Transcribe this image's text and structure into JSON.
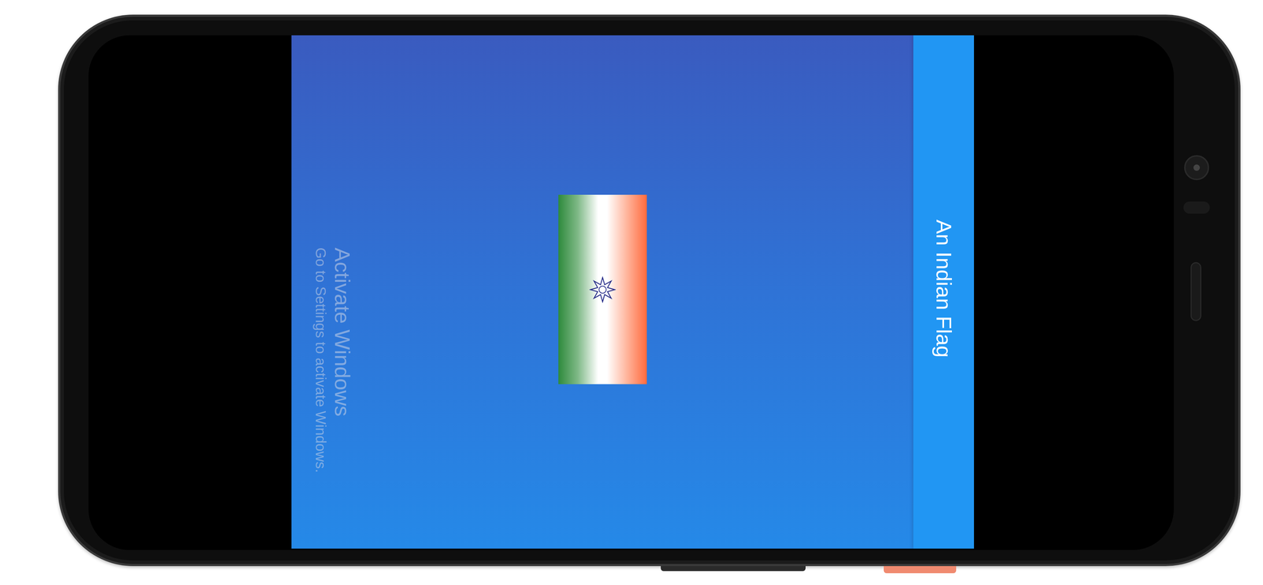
{
  "app_bar": {
    "title": "An Indian Flag"
  },
  "watermark": {
    "title": "Activate Windows",
    "subtitle": "Go to Settings to activate Windows."
  }
}
